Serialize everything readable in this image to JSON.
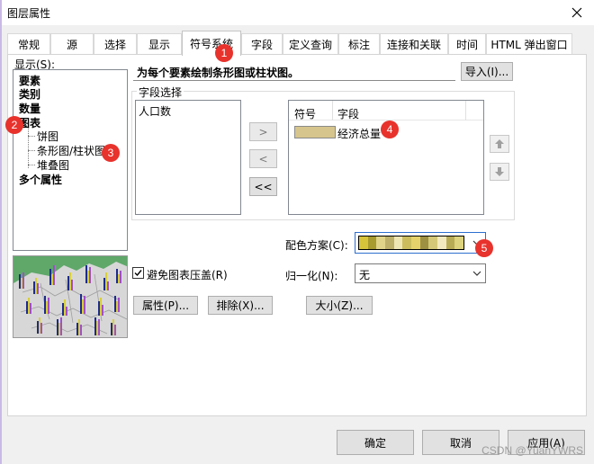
{
  "window": {
    "title": "图层属性",
    "close_icon": "close-icon"
  },
  "tabs": [
    {
      "label": "常规"
    },
    {
      "label": "源"
    },
    {
      "label": "选择"
    },
    {
      "label": "显示"
    },
    {
      "label": "符号系统",
      "active": true
    },
    {
      "label": "字段"
    },
    {
      "label": "定义查询"
    },
    {
      "label": "标注"
    },
    {
      "label": "连接和关联"
    },
    {
      "label": "时间"
    },
    {
      "label": "HTML 弹出窗口"
    }
  ],
  "show_label": "显示(S):",
  "tree": {
    "items": [
      {
        "label": "要素",
        "bold": true
      },
      {
        "label": "类别",
        "bold": true
      },
      {
        "label": "数量",
        "bold": true
      },
      {
        "label": "图表",
        "bold": true
      },
      {
        "label": "饼图",
        "bold": false
      },
      {
        "label": "条形图/柱状图",
        "bold": false
      },
      {
        "label": "堆叠图",
        "bold": false
      },
      {
        "label": "多个属性",
        "bold": true
      }
    ]
  },
  "description": "为每个要素绘制条形图或柱状图。",
  "import_button": "导入(I)...",
  "field_selection": {
    "title": "字段选择",
    "available_fields": [
      "人口数"
    ],
    "move_right": ">",
    "move_left": "<",
    "move_all_left": "<<",
    "table_headers": {
      "symbol": "符号",
      "field": "字段"
    },
    "rows": [
      {
        "field": "经济总量",
        "color": "#d6c58d"
      }
    ],
    "up_icon": "arrow-up-icon",
    "down_icon": "arrow-down-icon"
  },
  "color_scheme": {
    "label": "配色方案(C):",
    "colors": [
      "#d7c43a",
      "#a79a2f",
      "#e0d48a",
      "#bdb06b",
      "#efe6b5",
      "#cbbd5e",
      "#e5d26b",
      "#9e9043",
      "#d4c878",
      "#f2e9c0",
      "#b8ab56",
      "#ddd37e"
    ]
  },
  "normalize": {
    "label": "归一化(N):",
    "value": "无"
  },
  "avoid_overlap": {
    "label": "避免图表压盖(R)",
    "checked": true
  },
  "buttons": {
    "properties": "属性(P)...",
    "exclude": "排除(X)...",
    "size": "大小(Z)..."
  },
  "footer": {
    "ok": "确定",
    "cancel": "取消",
    "apply": "应用(A)"
  },
  "markers": [
    "1",
    "2",
    "3",
    "4",
    "5"
  ],
  "watermark": "CSDN @YuanYWRS"
}
